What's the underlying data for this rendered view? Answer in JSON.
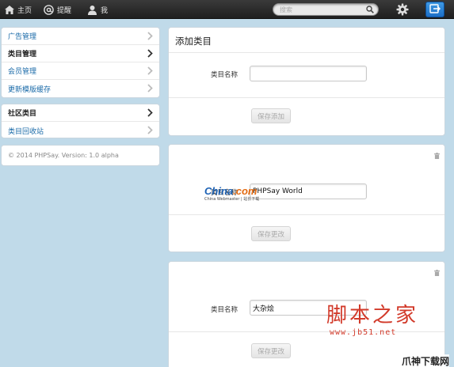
{
  "topnav": {
    "home_label": "主页",
    "mentions_label": "提醒",
    "me_label": "我",
    "search_placeholder": "搜索"
  },
  "sidebar": {
    "group1": [
      {
        "label": "广告管理",
        "active": false
      },
      {
        "label": "类目管理",
        "active": true
      },
      {
        "label": "会员管理",
        "active": false
      },
      {
        "label": "更新模版缓存",
        "active": false
      }
    ],
    "group2": [
      {
        "label": "社区类目",
        "active": true
      },
      {
        "label": "类目回收站",
        "active": false
      }
    ],
    "footer": "© 2014 PHPSay. Version: 1.0 alpha"
  },
  "add_panel": {
    "title": "添加类目",
    "field_label": "类目名称",
    "field_value": "",
    "button_label": "保存添加"
  },
  "category_panels": [
    {
      "field_label": "类目名称",
      "field_value": "PHPSay World",
      "button_label": "保存更改"
    },
    {
      "field_label": "类目名称",
      "field_value": "大杂烩",
      "button_label": "保存更改"
    }
  ],
  "watermarks": {
    "china_big": "China",
    "china_big2": ".com",
    "china_small": "China Webmaster | 站长下载",
    "jb_cn": "脚本之家",
    "jb_url": "www.jb51.net",
    "corner": "爪神下载网"
  },
  "colors": {
    "background": "#c0dae9",
    "link": "#1a6aa8",
    "accent": "#1c6fc7"
  },
  "icons": {
    "home": "home-icon",
    "mentions": "at-icon",
    "me": "user-icon",
    "search": "search-icon",
    "settings": "gear-icon",
    "compose": "compose-icon",
    "chevron": "chevron-right-icon",
    "trash": "trash-icon"
  }
}
